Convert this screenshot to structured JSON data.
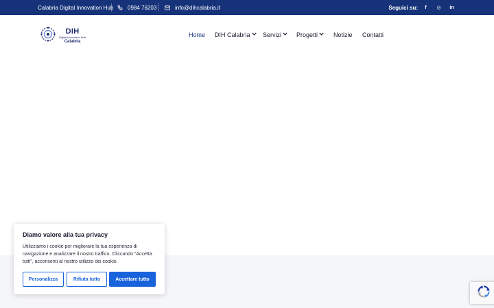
{
  "topbar": {
    "org_name": "Calabria Digital Innovation Hub",
    "phone": "0984 76203",
    "email": "info@dihcalabria.it",
    "follow_label": "Seguici su:",
    "social": [
      {
        "icon": "facebook-icon",
        "glyph": "f"
      },
      {
        "icon": "instagram-icon",
        "glyph": "◎"
      },
      {
        "icon": "linkedin-icon",
        "glyph": "in"
      }
    ]
  },
  "logo": {
    "line1": "DIH",
    "line2": "Digital Innovation Hub",
    "line3": "Calabria"
  },
  "nav": {
    "items": [
      {
        "label": "Home",
        "active": true,
        "dropdown": false
      },
      {
        "label": "DIH Calabria",
        "active": false,
        "dropdown": true
      },
      {
        "label": "Servizi",
        "active": false,
        "dropdown": true
      },
      {
        "label": "Progetti",
        "active": false,
        "dropdown": true
      },
      {
        "label": "Notizie",
        "active": false,
        "dropdown": false
      },
      {
        "label": "Contatti",
        "active": false,
        "dropdown": false
      }
    ]
  },
  "cookie": {
    "title": "Diamo valore alla tua privacy",
    "text": "Utilizziamo i cookie per migliorare la tua esperienza di navigazione e analizzare il nostro traffico. Cliccando \"Accetta tutti\", acconsenti al nostro utilizzo dei cookie.",
    "customize_label": "Personalizza",
    "reject_label": "Rifiuta tutto",
    "accept_label": "Accettare tutto"
  },
  "colors": {
    "topbar_bg": "#16337a",
    "accent": "#1863dc",
    "gray_band": "#f5f6fa"
  }
}
